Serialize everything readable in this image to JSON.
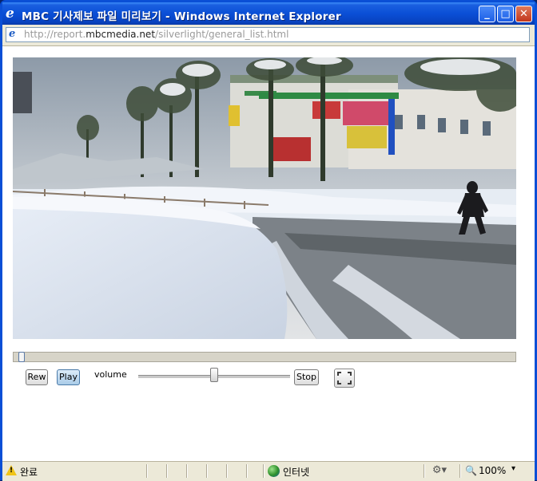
{
  "window": {
    "title": "MBC 기사제보 파일 미리보기 - Windows Internet Explorer",
    "icon": "ie-icon",
    "controls": {
      "minimize": "_",
      "maximize": "□",
      "close": "✕"
    }
  },
  "address": {
    "url_prefix": "http://report.",
    "url_domain": "mbcmedia.net",
    "url_suffix": "/silverlight/general_list.html"
  },
  "player": {
    "video": "snowy street scene with a person walking",
    "seek_progress": 0.01,
    "rew_label": "Rew",
    "play_label": "Play",
    "volume_label": "volume",
    "volume_level": 0.5,
    "stop_label": "Stop",
    "fullscreen_icon": "fullscreen-icon"
  },
  "status_bar": {
    "status_text": "완료",
    "zone_text": "인터넷",
    "zoom_text": "100%",
    "colors": {
      "warning": "#f0c419"
    }
  }
}
